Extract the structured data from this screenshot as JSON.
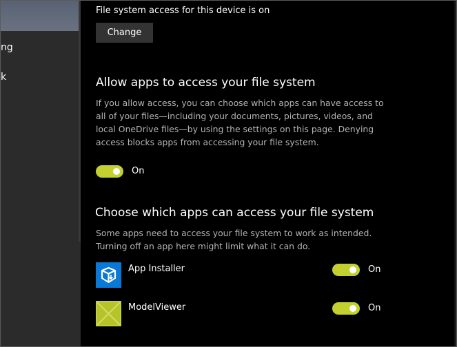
{
  "nav": {
    "items": [
      {
        "label": "ng"
      },
      {
        "label": "k"
      }
    ]
  },
  "device_access": {
    "status": "File system access for this device is on",
    "change_label": "Change"
  },
  "allow_section": {
    "heading": "Allow apps to access your file system",
    "description": "If you allow access, you can choose which apps can have access to all of your files—including your documents, pictures, videos, and local OneDrive files—by using the settings on this page. Denying access blocks apps from accessing your file system.",
    "toggle": {
      "state": "on",
      "label": "On"
    }
  },
  "apps_section": {
    "heading": "Choose which apps can access your file system",
    "description": "Some apps need to access your file system to work as intended. Turning off an app here might limit what it can do.",
    "apps": [
      {
        "name": "App Installer",
        "icon": "app-installer-icon",
        "icon_color": "#0a78d7",
        "toggle_state": "on",
        "toggle_label": "On"
      },
      {
        "name": "ModelViewer",
        "icon": "model-viewer-icon",
        "icon_color": "#b7c427",
        "toggle_state": "on",
        "toggle_label": "On"
      }
    ]
  },
  "colors": {
    "accent": "#c3d02f",
    "background": "#000000",
    "nav_background": "#2b2b2b",
    "secondary_text": "#b4b4b4"
  }
}
